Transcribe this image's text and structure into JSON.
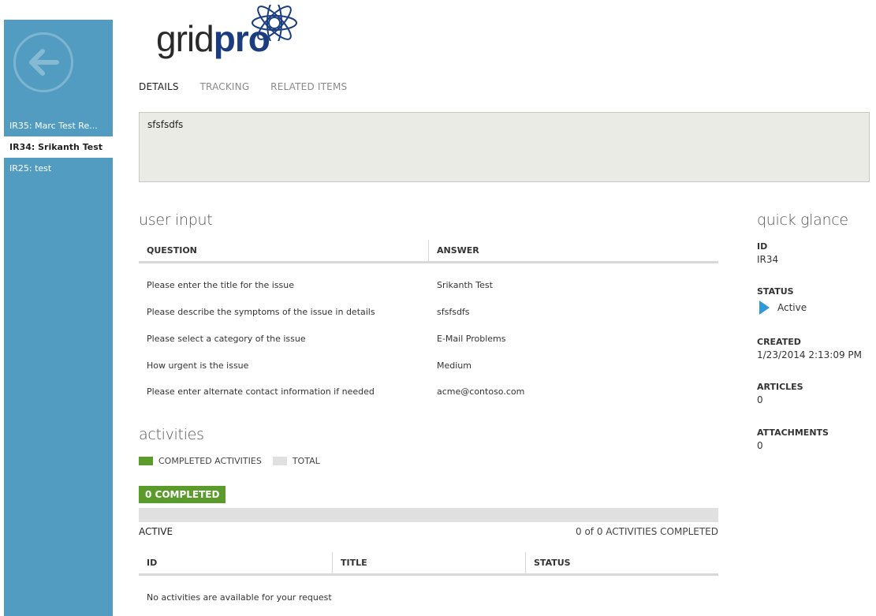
{
  "sidebar": {
    "items": [
      {
        "label": "IR35: Marc Test Re...",
        "selected": false
      },
      {
        "label": "IR34: Srikanth Test",
        "selected": true
      },
      {
        "label": "IR25: test",
        "selected": false
      }
    ]
  },
  "logo": {
    "part1": "grid",
    "part2": "pro"
  },
  "tabs": [
    {
      "label": "DETAILS",
      "active": true
    },
    {
      "label": "TRACKING",
      "active": false
    },
    {
      "label": "RELATED ITEMS",
      "active": false
    }
  ],
  "description": "sfsfsdfs",
  "user_input": {
    "title": "user input",
    "columns": [
      "QUESTION",
      "ANSWER"
    ],
    "rows": [
      {
        "question": "Please enter the title for the issue",
        "answer": "Srikanth Test"
      },
      {
        "question": "Please describe the symptoms of the issue in details",
        "answer": "sfsfsdfs"
      },
      {
        "question": "Please select a category of the issue",
        "answer": "E-Mail Problems"
      },
      {
        "question": "How urgent is the issue",
        "answer": "Medium"
      },
      {
        "question": "Please enter alternate contact information if needed",
        "answer": "acme@contoso.com"
      }
    ]
  },
  "activities": {
    "title": "activities",
    "legend_completed": "COMPLETED ACTIVITIES",
    "legend_total": "TOTAL",
    "completed_badge": "0 COMPLETED",
    "progress_fraction": 0,
    "active_label": "ACTIVE",
    "count_text": "0 of 0 ACTIVITIES COMPLETED",
    "columns": [
      "ID",
      "TITLE",
      "STATUS"
    ],
    "empty_message": "No activities are available for your request"
  },
  "quick_glance": {
    "title": "quick glance",
    "id_label": "ID",
    "id_value": "IR34",
    "status_label": "STATUS",
    "status_value": "Active",
    "created_label": "CREATED",
    "created_value": "1/23/2014 2:13:09 PM",
    "articles_label": "ARTICLES",
    "articles_value": "0",
    "attachments_label": "ATTACHMENTS",
    "attachments_value": "0"
  },
  "colors": {
    "sidebar": "#529cc1",
    "completed": "#5b9b2c",
    "total": "#e0e0e0",
    "status_active": "#2e9ad8",
    "logo_pro": "#1b3d80"
  }
}
